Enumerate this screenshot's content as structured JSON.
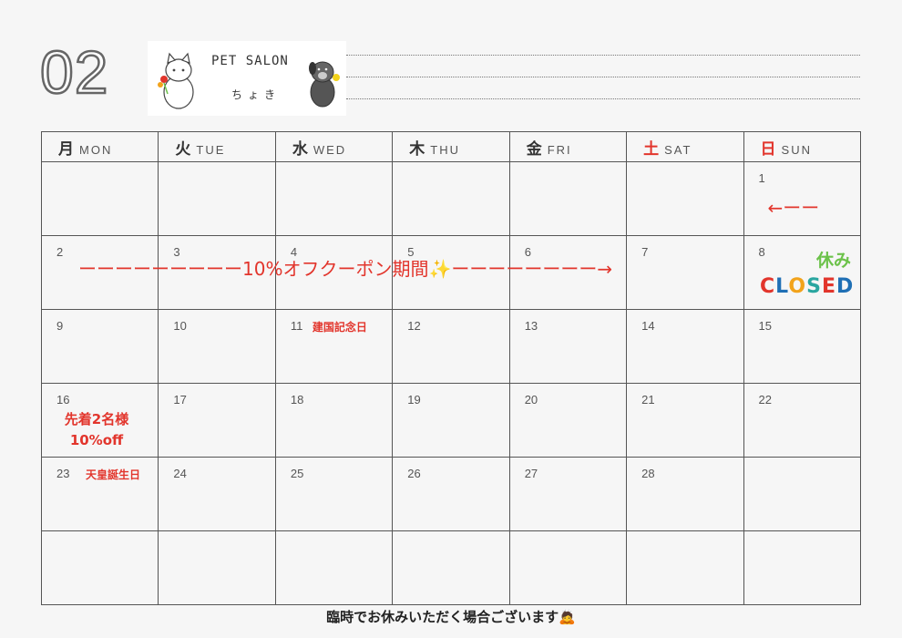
{
  "header": {
    "month": "02",
    "logo": {
      "title": "PET SALON",
      "subtitle": "ちょき"
    }
  },
  "weekdays": [
    {
      "kanji": "月",
      "en": "MON"
    },
    {
      "kanji": "火",
      "en": "TUE"
    },
    {
      "kanji": "水",
      "en": "WED"
    },
    {
      "kanji": "木",
      "en": "THU"
    },
    {
      "kanji": "金",
      "en": "FRI"
    },
    {
      "kanji": "土",
      "en": "SAT"
    },
    {
      "kanji": "日",
      "en": "SUN"
    }
  ],
  "weeks": [
    [
      "",
      "",
      "",
      "",
      "",
      "",
      "1"
    ],
    [
      "2",
      "3",
      "4",
      "5",
      "6",
      "7",
      "8"
    ],
    [
      "9",
      "10",
      "11",
      "12",
      "13",
      "14",
      "15"
    ],
    [
      "16",
      "17",
      "18",
      "19",
      "20",
      "21",
      "22"
    ],
    [
      "23",
      "24",
      "25",
      "26",
      "27",
      "28",
      ""
    ],
    [
      "",
      "",
      "",
      "",
      "",
      "",
      ""
    ]
  ],
  "events": {
    "arrow_day1": "←ーー",
    "coupon_banner": "ーーーーーーーーー10%オフクーポン期間✨ーーーーーーーー→",
    "closed_label": "休み",
    "closed_letters": [
      "C",
      "L",
      "O",
      "S",
      "E",
      "D"
    ],
    "closed_colors": [
      "#e2352c",
      "#1f6fb5",
      "#f2a31b",
      "#2aa6a0",
      "#e2352c",
      "#1f6fb5"
    ],
    "holiday_11": "建国記念日",
    "promo_16_line1": "先着2名様",
    "promo_16_line2": "10%off",
    "holiday_23": "天皇誕生日"
  },
  "footer": {
    "note": "臨時でお休みいただく場合ございます🙇"
  },
  "colors": {
    "red": "#e2352c",
    "green": "#6cc24a",
    "grid": "#555555"
  }
}
